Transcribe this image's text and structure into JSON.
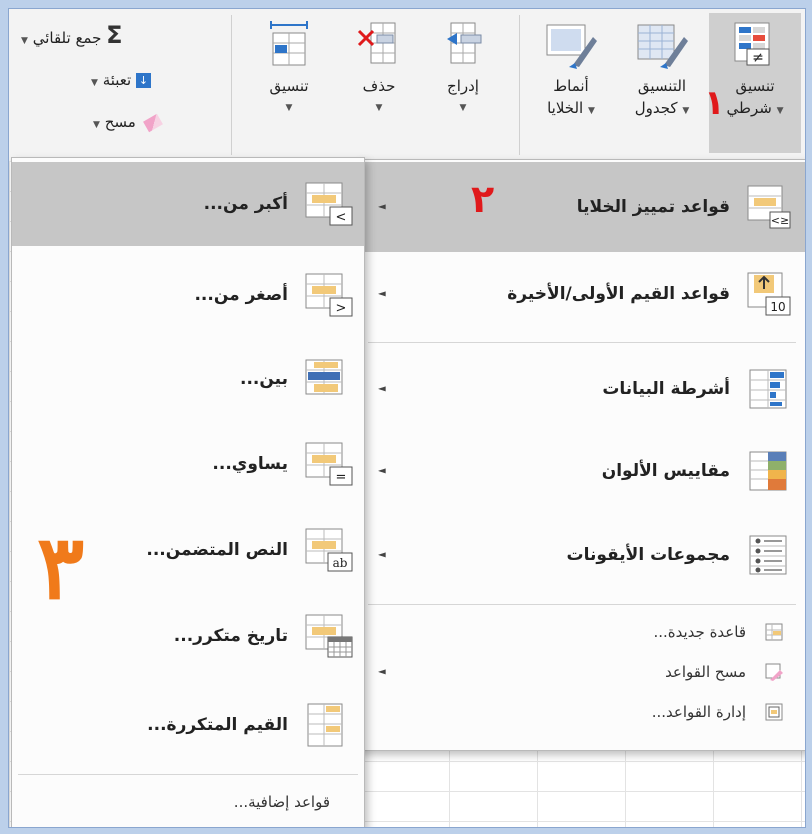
{
  "ribbon": {
    "conditional_formatting": {
      "line1": "تنسيق",
      "line2": "شرطي"
    },
    "format_as_table": {
      "line1": "التنسيق",
      "line2": "كجدول"
    },
    "cell_styles": {
      "line1": "أنماط",
      "line2": "الخلايا"
    },
    "insert": "إدراج",
    "delete": "حذف",
    "format": "تنسيق",
    "autosum": "جمع تلقائي",
    "fill": "تعبئة",
    "clear": "مسح"
  },
  "menu1": {
    "items": [
      {
        "label": "قواعد تمييز الخلايا",
        "icon": "highlight-cells-rules-icon"
      },
      {
        "label": "قواعد القيم الأولى/الأخيرة",
        "icon": "top-bottom-rules-icon"
      },
      {
        "label": "أشرطة البيانات",
        "icon": "data-bars-icon"
      },
      {
        "label": "مقاييس الألوان",
        "icon": "color-scales-icon"
      },
      {
        "label": "مجموعات الأيقونات",
        "icon": "icon-sets-icon"
      }
    ],
    "small_items": [
      {
        "label": "قاعدة جديدة...",
        "icon": "new-rule-icon"
      },
      {
        "label": "مسح القواعد",
        "icon": "clear-rules-icon"
      },
      {
        "label": "إدارة القواعد...",
        "icon": "manage-rules-icon"
      }
    ]
  },
  "menu2": {
    "items": [
      {
        "label": "أكبر من...",
        "icon": "greater-than-icon",
        "glyph": ">"
      },
      {
        "label": "أصغر من...",
        "icon": "less-than-icon",
        "glyph": "<"
      },
      {
        "label": "بين...",
        "icon": "between-icon",
        "glyph": ""
      },
      {
        "label": "يساوي...",
        "icon": "equal-to-icon",
        "glyph": "="
      },
      {
        "label": "النص المتضمن...",
        "icon": "text-contains-icon",
        "glyph": "ab"
      },
      {
        "label": "تاريخ متكرر...",
        "icon": "date-occurring-icon",
        "glyph": ""
      },
      {
        "label": "القيم المتكررة...",
        "icon": "duplicate-values-icon",
        "glyph": ""
      }
    ],
    "more_rules": "قواعد إضافية..."
  },
  "icon_glyphs": {
    "le": "≤>",
    "ne": "≠",
    "ten": "10"
  },
  "annotations": {
    "step1": "١",
    "step2": "٢",
    "step3": "٣"
  },
  "colors": {
    "highlight": "#c6c6c6",
    "annotation_red": "#e0191b",
    "annotation_orange": "#f07a1a",
    "accent_blue": "#2e75c9"
  }
}
